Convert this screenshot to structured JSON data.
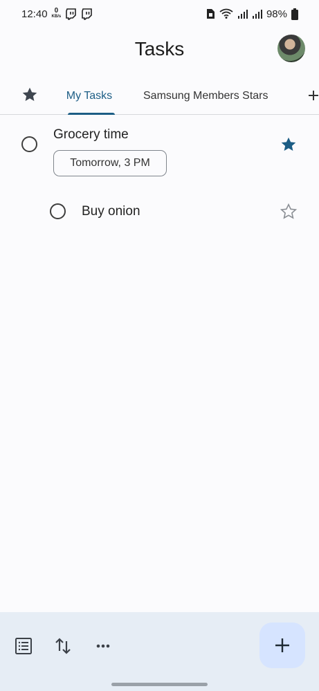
{
  "status_bar": {
    "time": "12:40",
    "network_speed_value": "0",
    "network_speed_unit": "KB/s",
    "battery_percent": "98%",
    "icons": [
      "twitch-icon",
      "twitch-icon",
      "sim-icon",
      "wifi-icon",
      "signal-icon",
      "signal-icon",
      "battery-icon"
    ]
  },
  "header": {
    "title": "Tasks"
  },
  "tabs": {
    "starred_icon": "star-icon",
    "items": [
      {
        "label": "My Tasks",
        "selected": true
      },
      {
        "label": "Samsung Members Stars",
        "selected": false
      }
    ],
    "add_icon": "plus-icon"
  },
  "tasks": [
    {
      "title": "Grocery time",
      "due": "Tomorrow, 3 PM",
      "starred": true,
      "subtasks": [
        {
          "title": "Buy onion",
          "starred": false
        }
      ]
    }
  ],
  "bottom_bar": {
    "icons": [
      "list-icon",
      "sort-icon",
      "more-icon"
    ],
    "fab_icon": "plus-icon"
  },
  "colors": {
    "accent": "#1c5d85",
    "fab_background": "#d6e4ff",
    "bottom_bar": "#e6edf5"
  }
}
